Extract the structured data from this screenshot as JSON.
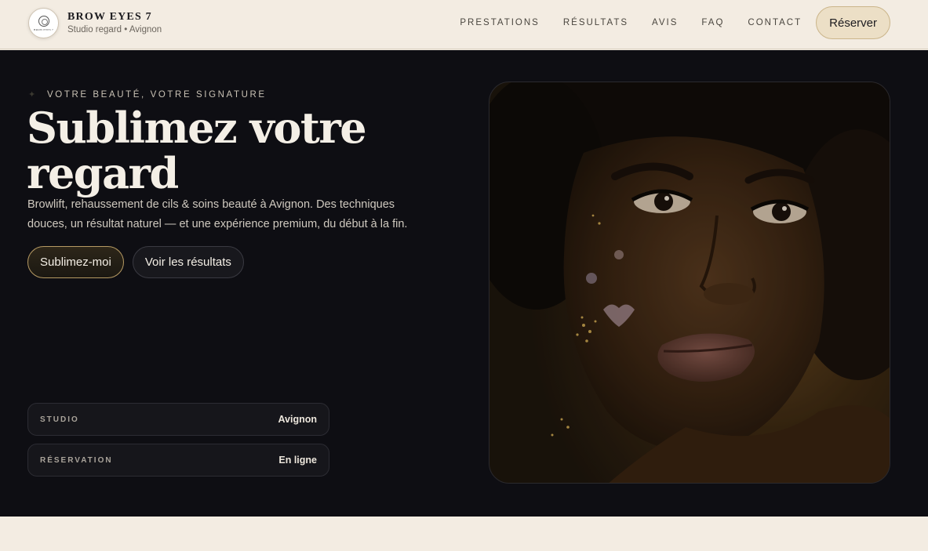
{
  "header": {
    "brand_name": "BROW EYES 7",
    "brand_subtitle": "Studio regard • Avignon",
    "logo_text": "BROW EYES 7",
    "nav": [
      {
        "label": "PRESTATIONS"
      },
      {
        "label": "RÉSULTATS"
      },
      {
        "label": "AVIS"
      },
      {
        "label": "FAQ"
      },
      {
        "label": "CONTACT"
      }
    ],
    "cta_label": "Réserver"
  },
  "hero": {
    "eyebrow_icon": "sparkle-icon",
    "eyebrow": "VOTRE BEAUTÉ, VOTRE SIGNATURE",
    "title_line1": "Sublimez votre",
    "title_line2": "regard",
    "description": "Browlift, rehaussement de cils & soins beauté à Avignon. Des techniques douces, un résultat naturel — et une expérience premium, du début à la fin.",
    "primary_button": "Sublimez-moi",
    "secondary_button": "Voir les résultats",
    "info": [
      {
        "label": "STUDIO",
        "value": "Avignon"
      },
      {
        "label": "RÉSERVATION",
        "value": "En ligne"
      }
    ]
  },
  "colors": {
    "page_background": "#f3ece2",
    "hero_background": "#0e0e13",
    "accent_gold": "#b69a63",
    "cta_background": "#ecdfc6"
  }
}
